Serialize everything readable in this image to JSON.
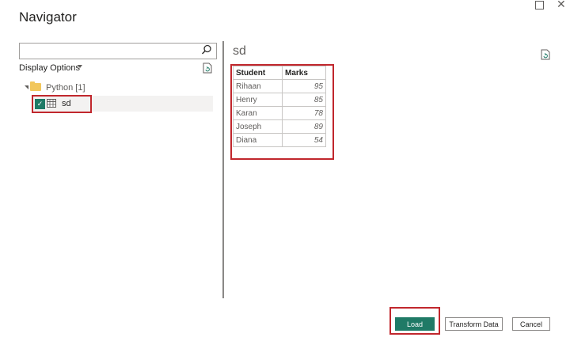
{
  "window": {
    "title": "Navigator",
    "maximize_icon": "maximize-icon",
    "close_glyph": "✕"
  },
  "left_panel": {
    "search": {
      "value": "",
      "placeholder": ""
    },
    "display_options_label": "Display Options",
    "tree": {
      "source_label": "Python [1]",
      "items": [
        {
          "label": "sd",
          "checked": true
        }
      ]
    }
  },
  "preview": {
    "title": "sd",
    "columns": [
      "Student",
      "Marks"
    ],
    "rows": [
      [
        "Rihaan",
        "95"
      ],
      [
        "Henry",
        "85"
      ],
      [
        "Karan",
        "78"
      ],
      [
        "Joseph",
        "89"
      ],
      [
        "Diana",
        "54"
      ]
    ]
  },
  "footer": {
    "load_label": "Load",
    "transform_label": "Transform Data",
    "cancel_label": "Cancel"
  },
  "colors": {
    "accent": "#1f7a66",
    "highlight": "#c1272d",
    "folder": "#f2c75c"
  }
}
